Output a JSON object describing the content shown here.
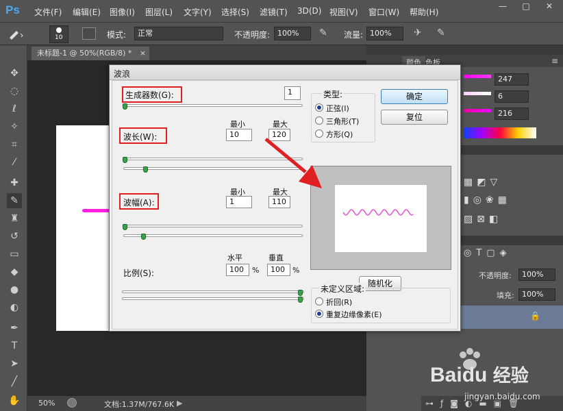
{
  "app": {
    "logo": "Ps"
  },
  "menu": [
    "文件(F)",
    "编辑(E)",
    "图像(I)",
    "图层(L)",
    "文字(Y)",
    "选择(S)",
    "滤镜(T)",
    "3D(D)",
    "视图(V)",
    "窗口(W)",
    "帮助(H)"
  ],
  "window_controls": {
    "minimize": "—",
    "maximize": "□",
    "close": "✕"
  },
  "options": {
    "brush_size": "10",
    "mode_label": "模式:",
    "mode_value": "正常",
    "opacity_label": "不透明度:",
    "opacity_value": "100%",
    "flow_label": "流量:",
    "flow_value": "100%"
  },
  "document": {
    "tab_label": "未标题-1 @ 50%(RGB/8) *",
    "tab_close": "×",
    "canvas_line_color": "#ff1fe6"
  },
  "status": {
    "zoom": "50%",
    "doc_info": "文档:1.37M/767.6K"
  },
  "color_panel": {
    "tabs": [
      "颜色",
      "色板"
    ],
    "values": [
      "247",
      "6",
      "216"
    ]
  },
  "layers_panel": {
    "opacity_label": "不透明度:",
    "opacity_value": "100%",
    "fill_label": "填充:",
    "fill_value": "100%"
  },
  "dialog": {
    "title": "波浪",
    "generators_label": "生成器数(G):",
    "generators_value": "1",
    "wavelength_label": "波长(W):",
    "amplitude_label": "波幅(A):",
    "min_label": "最小",
    "max_label": "最大",
    "wavelength_min": "10",
    "wavelength_max": "120",
    "amplitude_min": "1",
    "amplitude_max": "110",
    "scale_label": "比例(S):",
    "horizontal_label": "水平",
    "vertical_label": "垂直",
    "scale_h": "100",
    "scale_v": "100",
    "percent": "%",
    "type_label": "类型:",
    "type_options": [
      "正弦(I)",
      "三角形(T)",
      "方形(Q)"
    ],
    "type_selected": "正弦(I)",
    "ok_label": "确定",
    "reset_label": "复位",
    "randomize_label": "随机化",
    "undefined_area_label": "未定义区域:",
    "undefined_options": [
      "折回(R)",
      "重复边缘像素(E)"
    ],
    "undefined_selected": "重复边缘像素(E)",
    "wave_color": "#e23ad6",
    "annotation_color": "#e02020"
  },
  "watermark": {
    "brand": "Bai",
    "brand2": "du",
    "site_cn": "经验",
    "site_url": "jingyan.baidu.com"
  }
}
